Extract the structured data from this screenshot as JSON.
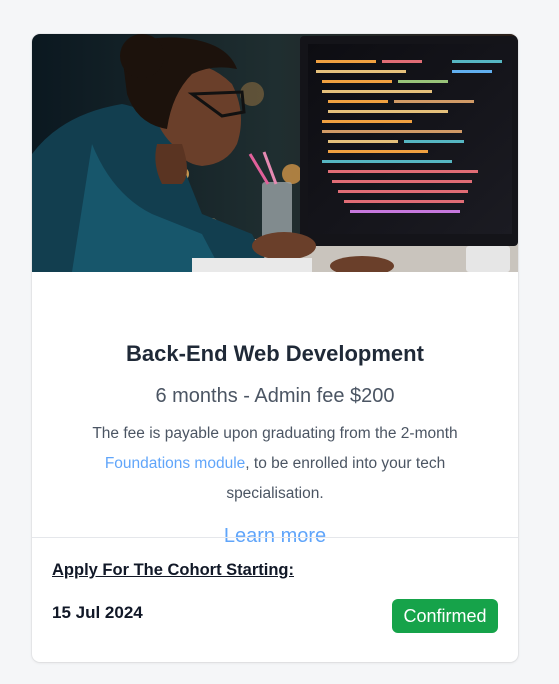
{
  "card": {
    "image_alt": "woman coding at computer",
    "title": "Back-End Web Development",
    "subtitle": "6 months - Admin fee $200",
    "description_pre": "The fee is payable upon graduating from the 2-month",
    "description_link": "Foundations module",
    "description_post": ", to be enrolled into your tech specialisation.",
    "learn_more": "Learn more",
    "apply_heading": "Apply For The Cohort Starting:",
    "start_date": "15 Jul 2024",
    "status_badge": "Confirmed"
  },
  "colors": {
    "link": "#60a5fa",
    "badge": "#16a34a",
    "title": "#1f2937"
  }
}
